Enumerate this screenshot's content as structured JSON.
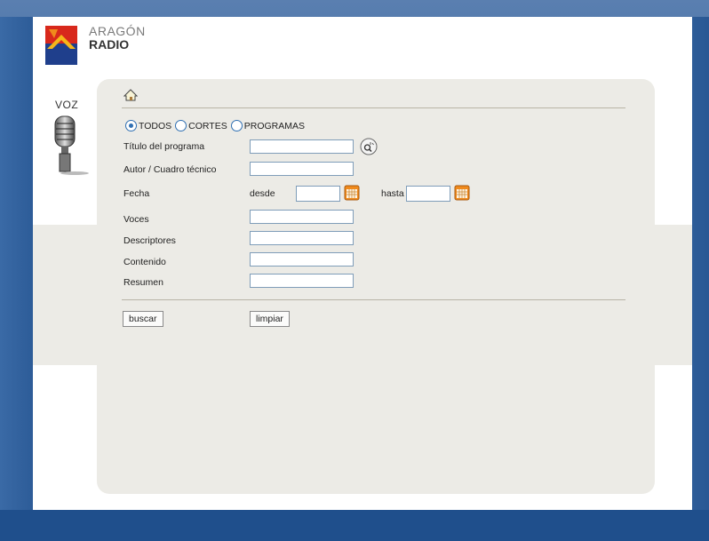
{
  "brand": {
    "line1": "ARAGÓN",
    "line2": "RADIO"
  },
  "side": {
    "voz": "VOZ"
  },
  "filters": {
    "options": [
      "TODOS",
      "CORTES",
      "PROGRAMAS"
    ],
    "selected": "TODOS"
  },
  "form": {
    "titulo_label": "Título del programa",
    "autor_label": "Autor / Cuadro técnico",
    "fecha_label": "Fecha",
    "desde_label": "desde",
    "hasta_label": "hasta",
    "voces_label": "Voces",
    "descriptores_label": "Descriptores",
    "contenido_label": "Contenido",
    "resumen_label": "Resumen",
    "titulo_value": "",
    "autor_value": "",
    "desde_value": "",
    "hasta_value": "",
    "voces_value": "",
    "descriptores_value": "",
    "contenido_value": "",
    "resumen_value": ""
  },
  "actions": {
    "buscar": "buscar",
    "limpiar": "limpiar"
  },
  "colors": {
    "page_bg_blue": "#1f4f8c",
    "panel_bg": "#ecebe6",
    "accent_radio": "#2f6fb2",
    "calendar_orange": "#f08a1c"
  },
  "icons": [
    "home-icon",
    "search-icon",
    "calendar-icon",
    "microphone-icon",
    "aragon-radio-logo"
  ]
}
